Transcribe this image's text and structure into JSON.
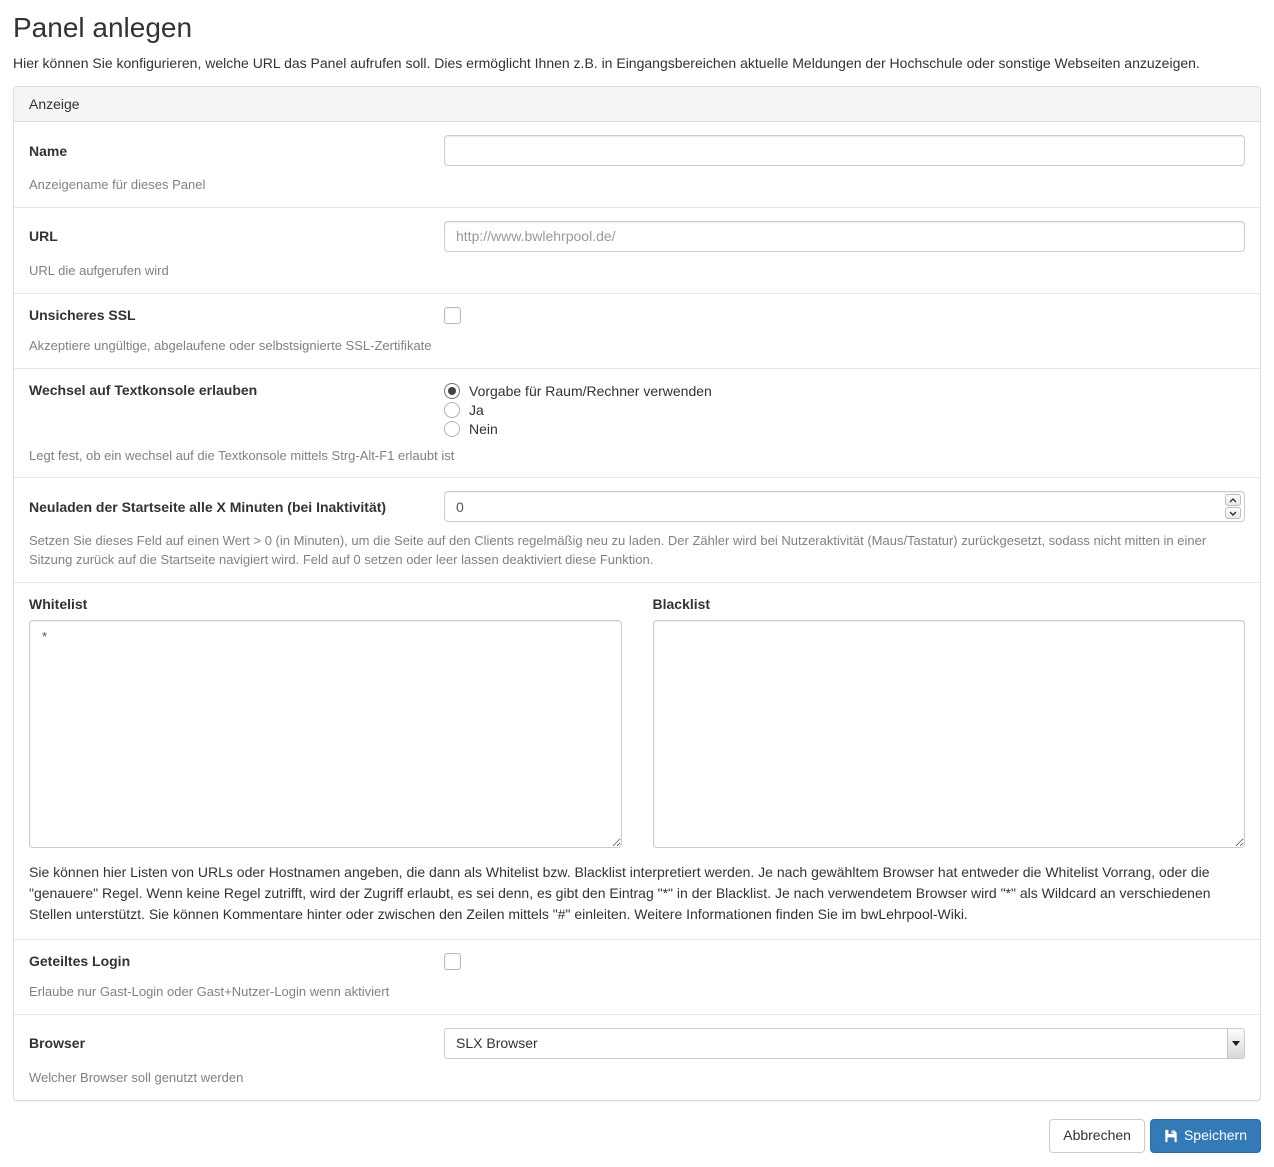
{
  "page": {
    "title": "Panel anlegen",
    "intro": "Hier können Sie konfigurieren, welche URL das Panel aufrufen soll. Dies ermöglicht Ihnen z.B. in Eingangsbereichen aktuelle Meldungen der Hochschule oder sonstige Webseiten anzuzeigen."
  },
  "panel": {
    "header": "Anzeige"
  },
  "fields": {
    "name": {
      "label": "Name",
      "value": "",
      "help": "Anzeigename für dieses Panel"
    },
    "url": {
      "label": "URL",
      "value": "",
      "placeholder": "http://www.bwlehrpool.de/",
      "help": "URL die aufgerufen wird"
    },
    "ssl": {
      "label": "Unsicheres SSL",
      "checked": false,
      "help": "Akzeptiere ungültige, abgelaufene oder selbstsignierte SSL-Zertifikate"
    },
    "textconsole": {
      "label": "Wechsel auf Textkonsole erlauben",
      "options": [
        {
          "label": "Vorgabe für Raum/Rechner verwenden",
          "selected": true
        },
        {
          "label": "Ja",
          "selected": false
        },
        {
          "label": "Nein",
          "selected": false
        }
      ],
      "help": "Legt fest, ob ein wechsel auf die Textkonsole mittels Strg-Alt-F1 erlaubt ist"
    },
    "reload": {
      "label": "Neuladen der Startseite alle X Minuten (bei Inaktivität)",
      "value": "0",
      "help": "Setzen Sie dieses Feld auf einen Wert > 0 (in Minuten), um die Seite auf den Clients regelmäßig neu zu laden. Der Zähler wird bei Nutzeraktivität (Maus/Tastatur) zurückgesetzt, sodass nicht mitten in einer Sitzung zurück auf die Startseite navigiert wird. Feld auf 0 setzen oder leer lassen deaktiviert diese Funktion."
    },
    "whitelist": {
      "label": "Whitelist",
      "value": "*"
    },
    "blacklist": {
      "label": "Blacklist",
      "value": ""
    },
    "lists_help": "Sie können hier Listen von URLs oder Hostnamen angeben, die dann als Whitelist bzw. Blacklist interpretiert werden. Je nach gewähltem Browser hat entweder die Whitelist Vorrang, oder die \"genauere\" Regel. Wenn keine Regel zutrifft, wird der Zugriff erlaubt, es sei denn, es gibt den Eintrag \"*\" in der Blacklist. Je nach verwendetem Browser wird \"*\" als Wildcard an verschiedenen Stellen unterstützt. Sie können Kommentare hinter oder zwischen den Zeilen mittels \"#\" einleiten. Weitere Informationen finden Sie im bwLehrpool-Wiki.",
    "sharedlogin": {
      "label": "Geteiltes Login",
      "checked": false,
      "help": "Erlaube nur Gast-Login oder Gast+Nutzer-Login wenn aktiviert"
    },
    "browser": {
      "label": "Browser",
      "value": "SLX Browser",
      "help": "Welcher Browser soll genutzt werden"
    }
  },
  "actions": {
    "cancel": "Abbrechen",
    "save": "Speichern",
    "save_icon": "floppy-disk-icon"
  },
  "colors": {
    "primary": "#337ab7",
    "primary_border": "#2e6da4",
    "panel_heading_bg": "#f5f5f5",
    "panel_border": "#dddddd",
    "row_divider": "#e8e8e8",
    "help_text": "#818181"
  }
}
